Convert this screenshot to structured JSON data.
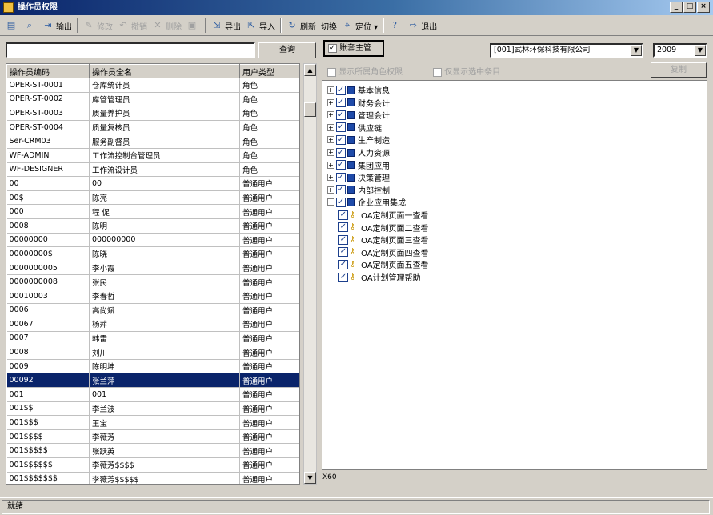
{
  "window": {
    "title": "操作员权限",
    "buttons": [
      "_",
      "□",
      "×"
    ]
  },
  "toolbar": [
    {
      "icon": "print-icon",
      "glyph": "▤",
      "label": "",
      "enabled": true
    },
    {
      "icon": "preview-icon",
      "glyph": "⌕",
      "label": "",
      "enabled": true
    },
    {
      "icon": "export-output-icon",
      "glyph": "⇥",
      "label": "输出",
      "enabled": true
    },
    {
      "icon": "modify-icon",
      "glyph": "✎",
      "label": "修改",
      "enabled": false
    },
    {
      "icon": "undo-icon",
      "glyph": "↶",
      "label": "撤销",
      "enabled": false
    },
    {
      "icon": "delete-icon",
      "glyph": "✕",
      "label": "删除",
      "enabled": false
    },
    {
      "icon": "save-icon",
      "glyph": "▣",
      "label": "",
      "enabled": false
    },
    {
      "icon": "export-icon",
      "glyph": "⇲",
      "label": "导出",
      "enabled": true
    },
    {
      "icon": "import-icon",
      "glyph": "⇱",
      "label": "导入",
      "enabled": true
    },
    {
      "icon": "refresh-icon",
      "glyph": "↻",
      "label": "刷新",
      "enabled": true
    },
    {
      "icon": "switch-icon",
      "glyph": "",
      "label": "切换",
      "enabled": true
    },
    {
      "icon": "locate-icon",
      "glyph": "⌖",
      "label": "定位 ▾",
      "enabled": true
    },
    {
      "icon": "help-icon",
      "glyph": "?",
      "label": "",
      "enabled": true
    },
    {
      "icon": "exit-icon",
      "glyph": "⇨",
      "label": "退出",
      "enabled": true
    }
  ],
  "search": {
    "value": "",
    "button_label": "查询"
  },
  "supervisor_checkbox": {
    "label": "账套主管",
    "checked": true
  },
  "company_select": {
    "value": "[001]武林环保科技有限公司"
  },
  "year_select": {
    "value": "2009"
  },
  "options": {
    "show_role_perms": "显示所属角色权限",
    "only_selected": "仅显示选中条目",
    "copy_button": "复制"
  },
  "grid": {
    "headers": [
      "操作员编码",
      "操作员全名",
      "用户类型"
    ],
    "rows": [
      [
        "OPER-ST-0001",
        "仓库统计员",
        "角色"
      ],
      [
        "OPER-ST-0002",
        "库管管理员",
        "角色"
      ],
      [
        "OPER-ST-0003",
        "质量养护员",
        "角色"
      ],
      [
        "OPER-ST-0004",
        "质量复核员",
        "角色"
      ],
      [
        "Ser-CRM03",
        "服务副督员",
        "角色"
      ],
      [
        "WF-ADMIN",
        "工作流控制台管理员",
        "角色"
      ],
      [
        "WF-DESIGNER",
        "工作流设计员",
        "角色"
      ],
      [
        "00",
        "00",
        "普通用户"
      ],
      [
        "00$",
        "陈亮",
        "普通用户"
      ],
      [
        "000",
        "程 促",
        "普通用户"
      ],
      [
        "0008",
        "陈明",
        "普通用户"
      ],
      [
        "00000000",
        "000000000",
        "普通用户"
      ],
      [
        "00000000$",
        "陈晓",
        "普通用户"
      ],
      [
        "0000000005",
        "李小霞",
        "普通用户"
      ],
      [
        "0000000008",
        "张民",
        "普通用户"
      ],
      [
        "00010003",
        "李春哲",
        "普通用户"
      ],
      [
        "0006",
        "高尚斌",
        "普通用户"
      ],
      [
        "00067",
        "杨萍",
        "普通用户"
      ],
      [
        "0007",
        "韩雷",
        "普通用户"
      ],
      [
        "0008",
        "刘川",
        "普通用户"
      ],
      [
        "0009",
        "陈明坤",
        "普通用户"
      ],
      [
        "00092",
        "张兰萍",
        "普通用户"
      ],
      [
        "001",
        "001",
        "普通用户"
      ],
      [
        "001$$",
        "李兰波",
        "普通用户"
      ],
      [
        "001$$$",
        "王宝",
        "普通用户"
      ],
      [
        "001$$$$",
        "李薇芳",
        "普通用户"
      ],
      [
        "001$$$$$",
        "张跃英",
        "普通用户"
      ],
      [
        "001$$$$$$",
        "李薇芳$$$$",
        "普通用户"
      ],
      [
        "001$$$$$$$",
        "李薇芳$$$$$",
        "普通用户"
      ]
    ],
    "selected_index": 21
  },
  "tree": {
    "groups": [
      "基本信息",
      "财务会计",
      "管理会计",
      "供应链",
      "生产制造",
      "人力资源",
      "集团应用",
      "决策管理",
      "内部控制",
      "企业应用集成"
    ],
    "children": [
      "OA定制页面一查看",
      "OA定制页面二查看",
      "OA定制页面三查看",
      "OA定制页面四查看",
      "OA定制页面五查看",
      "OA计划管理帮助"
    ]
  },
  "status": {
    "count": "X60",
    "text": "就绪"
  }
}
